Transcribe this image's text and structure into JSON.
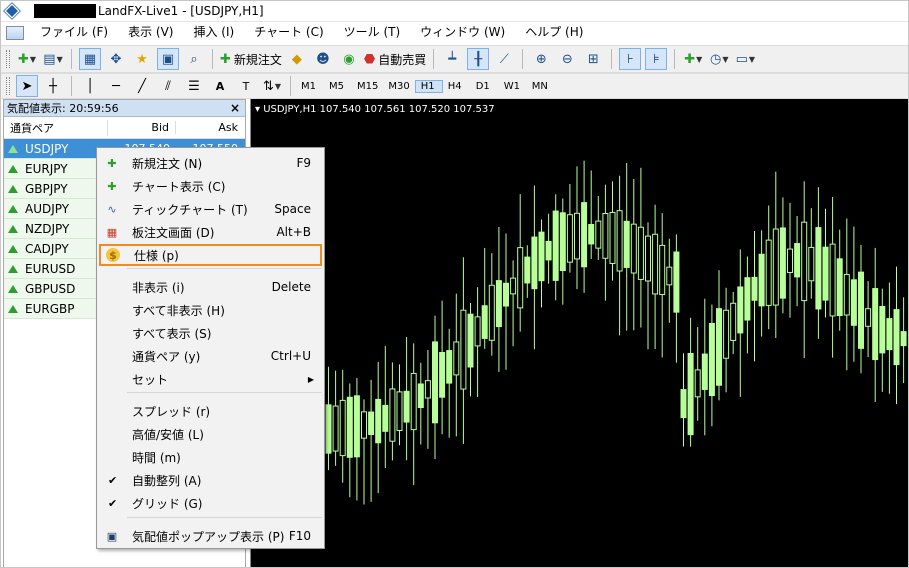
{
  "window": {
    "title": "LandFX-Live1 - [USDJPY,H1]"
  },
  "menu": [
    "ファイル (F)",
    "表示 (V)",
    "挿入 (I)",
    "チャート (C)",
    "ツール (T)",
    "ウィンドウ (W)",
    "ヘルプ (H)"
  ],
  "toolbar": {
    "new_order_label": "新規注文",
    "auto_trade_label": "自動売買"
  },
  "timeframes": [
    "M1",
    "M5",
    "M15",
    "M30",
    "H1",
    "H4",
    "D1",
    "W1",
    "MN"
  ],
  "selected_timeframe": "H1",
  "market_watch": {
    "title": "気配値表示: 20:59:56",
    "col_symbol": "通貨ペア",
    "col_bid": "Bid",
    "col_ask": "Ask",
    "rows": [
      {
        "symbol": "USDJPY",
        "bid": "107.540",
        "ask": "107.550",
        "selected": true
      },
      {
        "symbol": "EURJPY"
      },
      {
        "symbol": "GBPJPY"
      },
      {
        "symbol": "AUDJPY"
      },
      {
        "symbol": "NZDJPY"
      },
      {
        "symbol": "CADJPY"
      },
      {
        "symbol": "EURUSD"
      },
      {
        "symbol": "GBPUSD"
      },
      {
        "symbol": "EURGBP"
      }
    ]
  },
  "chart": {
    "info": "▾ USDJPY,H1  107.540 107.561 107.520 107.537"
  },
  "context_menu": {
    "items": [
      {
        "label": "新規注文 (N)",
        "shortcut": "F9",
        "icon": "new-order-icon"
      },
      {
        "label": "チャート表示 (C)",
        "shortcut": "",
        "icon": "chart-window-icon"
      },
      {
        "label": "ティックチャート (T)",
        "shortcut": "Space",
        "icon": "tick-chart-icon"
      },
      {
        "label": "板注文画面 (D)",
        "shortcut": "Alt+B",
        "icon": "depth-of-market-icon"
      },
      {
        "label": "仕様 (p)",
        "shortcut": "",
        "icon": "specification-icon",
        "highlighted": true
      },
      {
        "label": "非表示 (i)",
        "shortcut": "Delete"
      },
      {
        "label": "すべて非表示 (H)",
        "shortcut": ""
      },
      {
        "label": "すべて表示 (S)",
        "shortcut": ""
      },
      {
        "label": "通貨ペア (y)",
        "shortcut": "Ctrl+U"
      },
      {
        "label": "セット",
        "shortcut": "",
        "submenu": true
      },
      {
        "label": "スプレッド (r)",
        "shortcut": ""
      },
      {
        "label": "高値/安値 (L)",
        "shortcut": ""
      },
      {
        "label": "時間 (m)",
        "shortcut": ""
      },
      {
        "label": "自動整列 (A)",
        "shortcut": "",
        "checked": true
      },
      {
        "label": "グリッド (G)",
        "shortcut": "",
        "checked": true
      },
      {
        "label": "気配値ポップアップ表示 (P)",
        "shortcut": "F10",
        "icon": "popup-prices-icon"
      }
    ]
  },
  "colors": {
    "accent": "#3d8fd6",
    "highlight_border": "#f08a24",
    "candle": "#b8ff9a"
  }
}
